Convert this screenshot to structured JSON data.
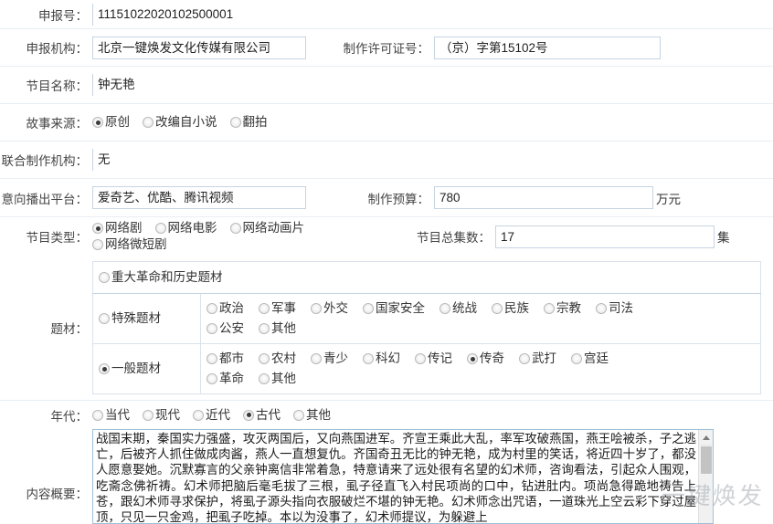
{
  "form": {
    "declaration_no": {
      "label": "申报号：",
      "value": "11151022020102500001"
    },
    "agency": {
      "label": "申报机构：",
      "value": "北京一键焕发文化传媒有限公司"
    },
    "license_no": {
      "label": "制作许可证号：",
      "value": "（京）字第15102号"
    },
    "program_name": {
      "label": "节目名称：",
      "value": "钟无艳"
    },
    "story_source": {
      "label": "故事来源：",
      "options": [
        {
          "label": "原创",
          "selected": true
        },
        {
          "label": "改编自小说",
          "selected": false
        },
        {
          "label": "翻拍",
          "selected": false
        }
      ]
    },
    "joint_agency": {
      "label": "联合制作机构：",
      "value": "无"
    },
    "platform": {
      "label": "意向播出平台：",
      "value": "爱奇艺、优酷、腾讯视频"
    },
    "budget": {
      "label": "制作预算：",
      "value": "780",
      "unit": "万元"
    },
    "program_type": {
      "label": "节目类型：",
      "options": [
        {
          "label": "网络剧",
          "selected": true
        },
        {
          "label": "网络电影",
          "selected": false
        },
        {
          "label": "网络动画片",
          "selected": false
        },
        {
          "label": "网络微短剧",
          "selected": false
        }
      ]
    },
    "total_episodes": {
      "label": "节目总集数：",
      "value": "17",
      "unit": "集"
    },
    "subject": {
      "label": "题材：",
      "groups": [
        {
          "category": {
            "label": "重大革命和历史题材",
            "selected": false
          },
          "options": []
        },
        {
          "category": {
            "label": "特殊题材",
            "selected": false
          },
          "options": [
            {
              "label": "政治",
              "selected": false
            },
            {
              "label": "军事",
              "selected": false
            },
            {
              "label": "外交",
              "selected": false
            },
            {
              "label": "国家安全",
              "selected": false
            },
            {
              "label": "统战",
              "selected": false
            },
            {
              "label": "民族",
              "selected": false
            },
            {
              "label": "宗教",
              "selected": false
            },
            {
              "label": "司法",
              "selected": false
            },
            {
              "label": "公安",
              "selected": false
            },
            {
              "label": "其他",
              "selected": false
            }
          ]
        },
        {
          "category": {
            "label": "一般题材",
            "selected": true
          },
          "options": [
            {
              "label": "都市",
              "selected": false
            },
            {
              "label": "农村",
              "selected": false
            },
            {
              "label": "青少",
              "selected": false
            },
            {
              "label": "科幻",
              "selected": false
            },
            {
              "label": "传记",
              "selected": false
            },
            {
              "label": "传奇",
              "selected": true
            },
            {
              "label": "武打",
              "selected": false
            },
            {
              "label": "宫廷",
              "selected": false
            },
            {
              "label": "革命",
              "selected": false
            },
            {
              "label": "其他",
              "selected": false
            }
          ]
        }
      ]
    },
    "era": {
      "label": "年代：",
      "options": [
        {
          "label": "当代",
          "selected": false
        },
        {
          "label": "现代",
          "selected": false
        },
        {
          "label": "近代",
          "selected": false
        },
        {
          "label": "古代",
          "selected": true
        },
        {
          "label": "其他",
          "selected": false
        }
      ]
    },
    "summary": {
      "label": "内容概要：",
      "value": "战国末期，秦国实力强盛，攻灭两国后，又向燕国进军。齐宣王乘此大乱，率军攻破燕国，燕王哙被杀，子之逃亡，后被齐人抓住做成肉酱，燕人一直想复仇。齐国奇丑无比的钟无艳，成为村里的笑话，将近四十岁了，都没人愿意娶她。沉默寡言的父亲钟离信非常着急，特意请来了远处很有名望的幻术师，咨询看法，引起众人围观，吃斋念佛祈祷。幻术师把脑后毫毛拔了三根，虱子径直飞入村民项尚的口中，钻进肚内。项尚急得跪地祷告上苍，跟幻术师寻求保护，将虱子源头指向衣服破烂不堪的钟无艳。幻术师念出咒语，一道珠光上空云彩下穿过屋顶，只见一只金鸡，把虱子吃掉。本以为没事了，幻术师提议，为躲避上"
    }
  },
  "watermark": {
    "text": "一键焕发"
  },
  "icons": {
    "scroll_up": "scroll-up-arrow-icon"
  }
}
